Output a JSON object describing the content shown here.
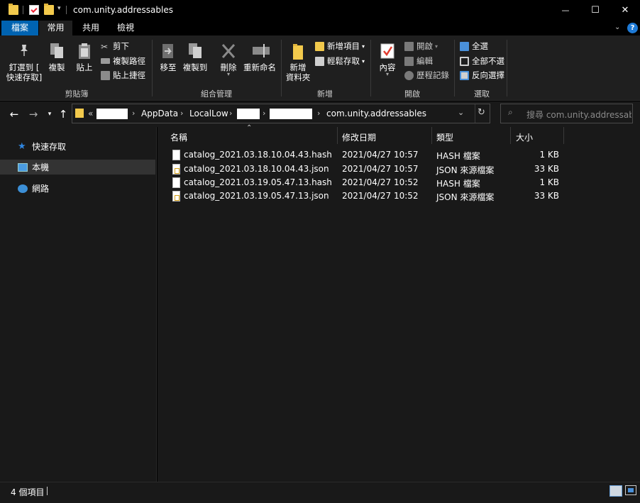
{
  "window": {
    "title": "com.unity.addressables",
    "minimize_glyph": "—",
    "maximize_glyph": "☐",
    "close_glyph": "✕"
  },
  "tabs": [
    {
      "label": "檔案"
    },
    {
      "label": "常用"
    },
    {
      "label": "共用"
    },
    {
      "label": "檢視"
    }
  ],
  "ribbon": {
    "pin_label_1": "釘選到 [",
    "pin_label_2": "快速存取]",
    "copy": "複製",
    "paste": "貼上",
    "cut": "剪下",
    "copy_path": "複製路徑",
    "paste_shortcut": "貼上捷徑",
    "group_clipboard": "剪貼簿",
    "move_to": "移至",
    "copy_to": "複製到",
    "delete": "刪除",
    "rename": "重新命名",
    "group_organize": "組合管理",
    "new_folder_1": "新增",
    "new_folder_2": "資料夾",
    "new_item": "新增項目",
    "easy_access": "輕鬆存取",
    "group_new": "新增",
    "properties": "內容",
    "open": "開啟",
    "edit": "編輯",
    "history": "歷程記錄",
    "group_open": "開啟",
    "select_all": "全選",
    "select_none": "全部不選",
    "invert_selection": "反向選擇",
    "group_select": "選取"
  },
  "address": {
    "overflow": "«",
    "crumbs": [
      "AppData",
      "LocalLow",
      "com.unity.addressables"
    ],
    "search_placeholder": "搜尋 com.unity.addressables"
  },
  "nav_pane": {
    "items": [
      {
        "label": "快速存取"
      },
      {
        "label": "本機"
      },
      {
        "label": "網路"
      }
    ]
  },
  "columns": {
    "name": "名稱",
    "date": "修改日期",
    "type": "類型",
    "size": "大小"
  },
  "files": [
    {
      "name": "catalog_2021.03.18.10.04.43.hash",
      "date": "2021/04/27 10:57",
      "type": "HASH 檔案",
      "size": "1 KB",
      "kind": "hash"
    },
    {
      "name": "catalog_2021.03.18.10.04.43.json",
      "date": "2021/04/27 10:57",
      "type": "JSON 來源檔案",
      "size": "33 KB",
      "kind": "json"
    },
    {
      "name": "catalog_2021.03.19.05.47.13.hash",
      "date": "2021/04/27 10:52",
      "type": "HASH 檔案",
      "size": "1 KB",
      "kind": "hash"
    },
    {
      "name": "catalog_2021.03.19.05.47.13.json",
      "date": "2021/04/27 10:52",
      "type": "JSON 來源檔案",
      "size": "33 KB",
      "kind": "json"
    }
  ],
  "status": {
    "item_count": "4 個項目"
  },
  "colors": {
    "accent": "#0063b1",
    "background": "#191919",
    "ribbon": "#1f1f1f",
    "selected_nav": "#333333"
  }
}
